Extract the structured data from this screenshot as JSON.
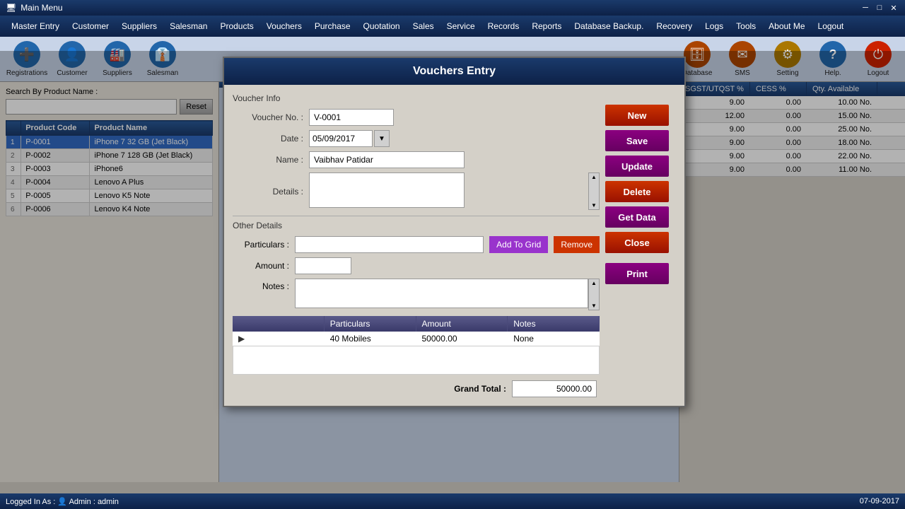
{
  "title_bar": {
    "title": "Main Menu",
    "min_btn": "─",
    "max_btn": "□",
    "close_btn": "✕"
  },
  "menu": {
    "items": [
      "Master Entry",
      "Customer",
      "Suppliers",
      "Salesman",
      "Products",
      "Vouchers",
      "Purchase",
      "Quotation",
      "Sales",
      "Service",
      "Records",
      "Reports",
      "Database Backup.",
      "Recovery",
      "Logs",
      "Tools",
      "About Me",
      "Logout"
    ]
  },
  "icons": [
    {
      "name": "registrations",
      "label": "Registrations",
      "color": "#2266aa",
      "icon": "➕"
    },
    {
      "name": "customer",
      "label": "Customer",
      "color": "#2266aa",
      "icon": "👤"
    },
    {
      "name": "suppliers",
      "label": "Suppliers",
      "color": "#2266aa",
      "icon": "🏭"
    },
    {
      "name": "salesman",
      "label": "Salesman",
      "color": "#2266aa",
      "icon": "👔"
    },
    {
      "name": "database",
      "label": "Database",
      "color": "#aa4400",
      "icon": "🗄"
    },
    {
      "name": "sms",
      "label": "SMS",
      "color": "#aa4400",
      "icon": "✉"
    },
    {
      "name": "setting",
      "label": "Setting",
      "color": "#aa7700",
      "icon": "⚙"
    },
    {
      "name": "help",
      "label": "Help.",
      "color": "#2266aa",
      "icon": "?"
    },
    {
      "name": "logout",
      "label": "Logout",
      "color": "#cc2200",
      "icon": "⏻"
    }
  ],
  "search": {
    "label": "Search By Product Name :",
    "placeholder": "",
    "reset_btn": "Reset"
  },
  "product_table": {
    "columns": [
      "",
      "Product Code",
      "Product Name"
    ],
    "rows": [
      {
        "num": "1",
        "code": "P-0001",
        "name": "iPhone 7 32 GB (Jet Black)",
        "selected": true
      },
      {
        "num": "2",
        "code": "P-0002",
        "name": "iPhone 7 128 GB (Jet Black)"
      },
      {
        "num": "3",
        "code": "P-0003",
        "name": "iPhone6"
      },
      {
        "num": "4",
        "code": "P-0004",
        "name": "Lenovo A Plus"
      },
      {
        "num": "5",
        "code": "P-0005",
        "name": "Lenovo K5 Note"
      },
      {
        "num": "6",
        "code": "P-0006",
        "name": "Lenovo K4 Note"
      }
    ]
  },
  "right_columns": {
    "headers": [
      "SGST/UTQST %",
      "CESS %",
      "Qty. Available"
    ],
    "rows": [
      {
        "sgst": "9.00",
        "cess": "0.00",
        "qty": "10.00 No."
      },
      {
        "sgst": "12.00",
        "cess": "0.00",
        "qty": "15.00 No."
      },
      {
        "sgst": "9.00",
        "cess": "0.00",
        "qty": "25.00 No."
      },
      {
        "sgst": "9.00",
        "cess": "0.00",
        "qty": "18.00 No."
      },
      {
        "sgst": "9.00",
        "cess": "0.00",
        "qty": "22.00 No."
      },
      {
        "sgst": "9.00",
        "cess": "0.00",
        "qty": "11.00 No."
      }
    ]
  },
  "modal": {
    "title": "Vouchers Entry",
    "voucher_info_label": "Voucher Info",
    "voucher_no_label": "Voucher No. :",
    "voucher_no_value": "V-0001",
    "date_label": "Date :",
    "date_value": "05/09/2017",
    "name_label": "Name :",
    "name_value": "Vaibhav Patidar",
    "details_label": "Details :",
    "details_value": "",
    "other_details_label": "Other Details",
    "particulars_label": "Particulars :",
    "particulars_value": "",
    "amount_label": "Amount :",
    "amount_value": "",
    "notes_label": "Notes :",
    "notes_value": "",
    "add_btn": "Add To Grid",
    "remove_btn": "Remove",
    "buttons": {
      "new": "New",
      "save": "Save",
      "update": "Update",
      "delete": "Delete",
      "get_data": "Get Data",
      "close": "Close",
      "print": "Print"
    },
    "grid": {
      "columns": [
        "Particulars",
        "Amount",
        "Notes"
      ],
      "rows": [
        {
          "particulars": "40 Mobiles",
          "amount": "50000.00",
          "notes": "None"
        }
      ]
    },
    "grand_total_label": "Grand Total :",
    "grand_total_value": "50000.00"
  },
  "status": {
    "logged_in_label": "Logged In As :",
    "user_icon": "👤",
    "role": "Admin",
    "separator": ":",
    "username": "admin",
    "date": "07-09-2017"
  }
}
